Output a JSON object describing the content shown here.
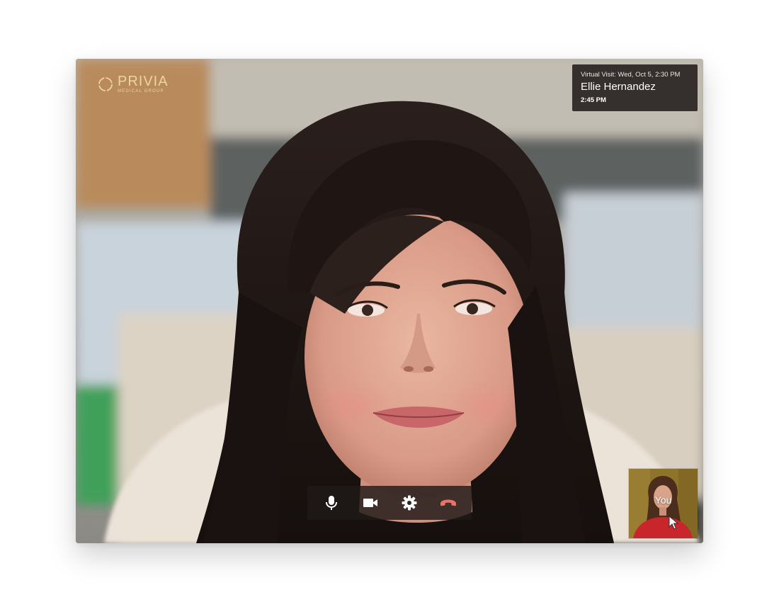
{
  "logo": {
    "name": "PRIVIA",
    "subtitle": "MEDICAL GROUP"
  },
  "visit": {
    "header": "Virtual Visit: Wed, Oct 5, 2:30 PM",
    "patient_name": "Ellie Hernandez",
    "elapsed_time": "2:45 PM"
  },
  "controls": {
    "icons": [
      "microphone-icon",
      "video-camera-icon",
      "settings-gear-icon",
      "end-call-icon"
    ],
    "end_call_color": "#e8736a"
  },
  "self_view": {
    "label": "You"
  },
  "colors": {
    "accent_gold": "#e8d5a0",
    "overlay_dark": "#1c1816"
  }
}
